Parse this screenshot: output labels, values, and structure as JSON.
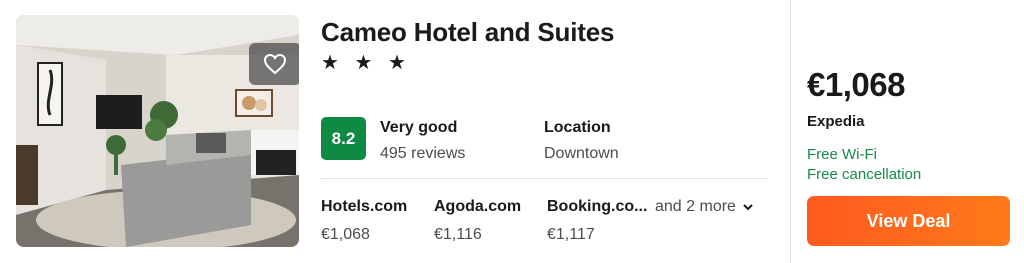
{
  "hotel": {
    "name": "Cameo Hotel and Suites",
    "stars": "★ ★ ★",
    "score": "8.2",
    "rating_text": "Very good",
    "reviews": "495 reviews",
    "location_label": "Location",
    "location_value": "Downtown"
  },
  "providers": [
    {
      "name": "Hotels.com",
      "price": "€1,068"
    },
    {
      "name": "Agoda.com",
      "price": "€1,116"
    },
    {
      "name": "Booking.co...",
      "price": "€1,117"
    }
  ],
  "more_providers": "and 2 more",
  "deal": {
    "price": "€1,068",
    "provider": "Expedia",
    "amenities": [
      "Free Wi-Fi",
      "Free cancellation"
    ],
    "button_label": "View Deal"
  },
  "icons": {
    "favorite": "heart-icon",
    "more": "chevron-down-icon"
  },
  "colors": {
    "score_bg": "#0f8a45",
    "amenity_text": "#168a4b",
    "deal_button": "#ff6a1c"
  }
}
